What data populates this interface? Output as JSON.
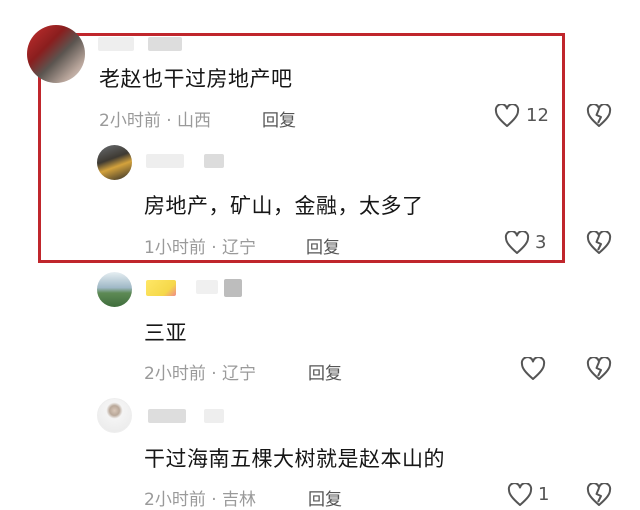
{
  "colors": {
    "highlight_border": "#c0262c",
    "meta_text": "#9a9a9a",
    "icon_stroke": "#555555"
  },
  "comments": [
    {
      "text": "老赵也干过房地产吧",
      "time": "2小时前",
      "location": "山西",
      "reply_label": "回复",
      "likes": "12"
    },
    {
      "text": "房地产，矿山，金融，太多了",
      "time": "1小时前",
      "location": "辽宁",
      "reply_label": "回复",
      "likes": "3"
    },
    {
      "text": "三亚",
      "time": "2小时前",
      "location": "辽宁",
      "reply_label": "回复",
      "likes": ""
    },
    {
      "text": "干过海南五棵大树就是赵本山的",
      "time": "2小时前",
      "location": "吉林",
      "reply_label": "回复",
      "likes": "1"
    }
  ],
  "meta_separator": " · ",
  "icons": {
    "like": "heart-outline-icon",
    "dislike": "broken-heart-icon"
  }
}
